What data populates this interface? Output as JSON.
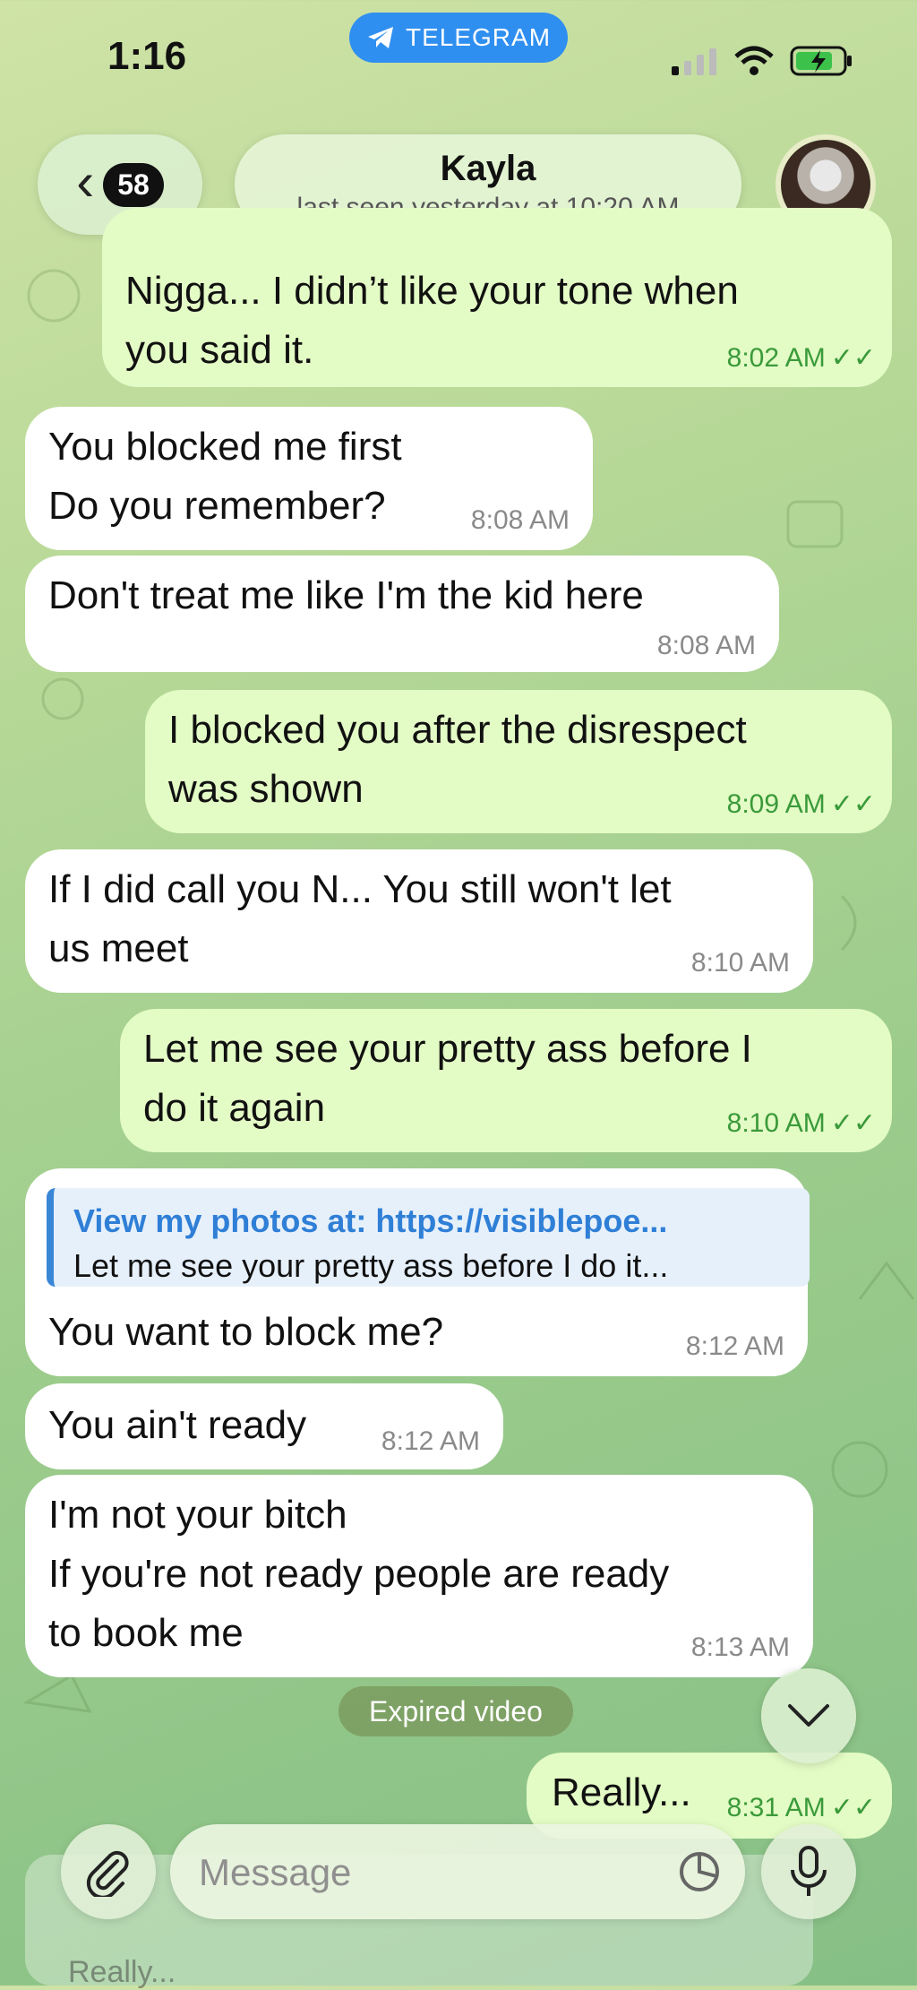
{
  "statusbar": {
    "time": "1:16",
    "app_pill": "TELEGRAM"
  },
  "header": {
    "back_count": "58",
    "contact_name": "Kayla",
    "last_seen": "last seen yesterday at 10:20 AM"
  },
  "messages": [
    {
      "dir": "out",
      "text": "Nigga... I didn’t like your tone when\nyou said it.",
      "time": "8:02 AM"
    },
    {
      "dir": "in",
      "text": "You blocked me first\nDo you remember?",
      "time": "8:08 AM"
    },
    {
      "dir": "in",
      "text": "Don't treat me like I'm the kid here",
      "time": "8:08 AM"
    },
    {
      "dir": "out",
      "text": "I blocked you after the disrespect\nwas shown",
      "time": "8:09 AM"
    },
    {
      "dir": "in",
      "text": "If I did call you N... You still won't let\nus meet",
      "time": "8:10 AM"
    },
    {
      "dir": "out",
      "text": "Let me see your pretty ass before I\ndo it again",
      "time": "8:10 AM"
    },
    {
      "dir": "in",
      "reply_title": "View my photos at: https://visiblepoe...",
      "reply_text": "Let me see your pretty ass before I do it...",
      "text": "You want to block me?",
      "time": "8:12 AM"
    },
    {
      "dir": "in",
      "text": "You ain't ready",
      "time": "8:12 AM"
    },
    {
      "dir": "in",
      "text": "I'm not your bitch\nIf you're not ready people are ready\nto book me",
      "time": "8:13 AM"
    },
    {
      "dir": "out",
      "text": "Really...",
      "time": "8:31 AM"
    }
  ],
  "system_pill": "Expired video",
  "composer": {
    "placeholder": "Message",
    "ghost_reply_text": "Really..."
  },
  "colors": {
    "accent": "#2f8ff0",
    "outgoing_bubble": "#e3fbc5",
    "incoming_bubble": "#ffffff",
    "read_check": "#3a9a3a"
  }
}
